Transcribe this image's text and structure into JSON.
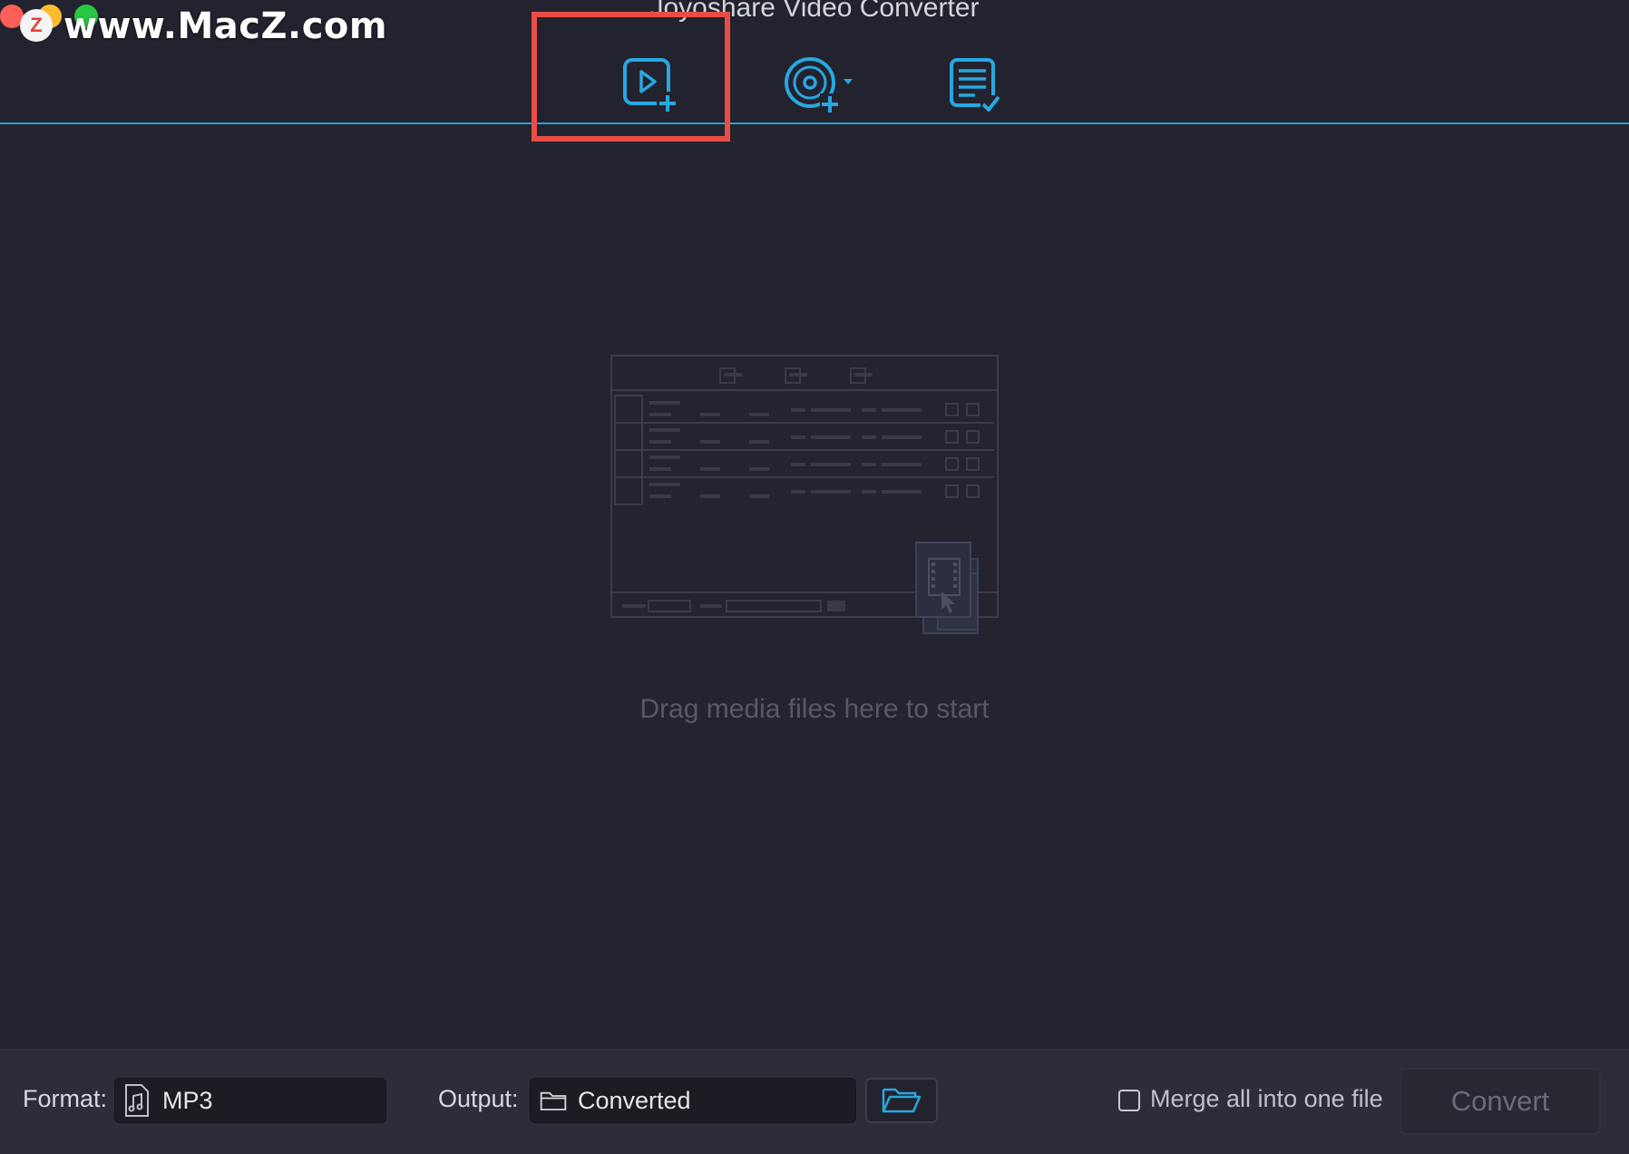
{
  "window": {
    "title": "Joyoshare Video Converter"
  },
  "watermark": {
    "logo_letter": "Z",
    "text": "www.MacZ.com"
  },
  "toolbar": {
    "items": [
      {
        "icon": "add-video-icon",
        "name": "add-files"
      },
      {
        "icon": "add-dvd-icon",
        "name": "add-dvd"
      },
      {
        "icon": "history-list-icon",
        "name": "history"
      }
    ],
    "highlighted_item": "add-files",
    "accent_color": "#29a7e1",
    "highlight_color": "#ea4d46"
  },
  "drop_zone": {
    "hint": "Drag media files here to start"
  },
  "bottom_bar": {
    "format_label": "Format:",
    "format_value": "MP3",
    "format_icon": "music-file-icon",
    "output_label": "Output:",
    "output_value": "Converted",
    "output_icon": "folder-icon",
    "browse_icon": "open-folder-icon",
    "merge_label": "Merge all into one file",
    "merge_checked": false,
    "convert_label": "Convert"
  }
}
